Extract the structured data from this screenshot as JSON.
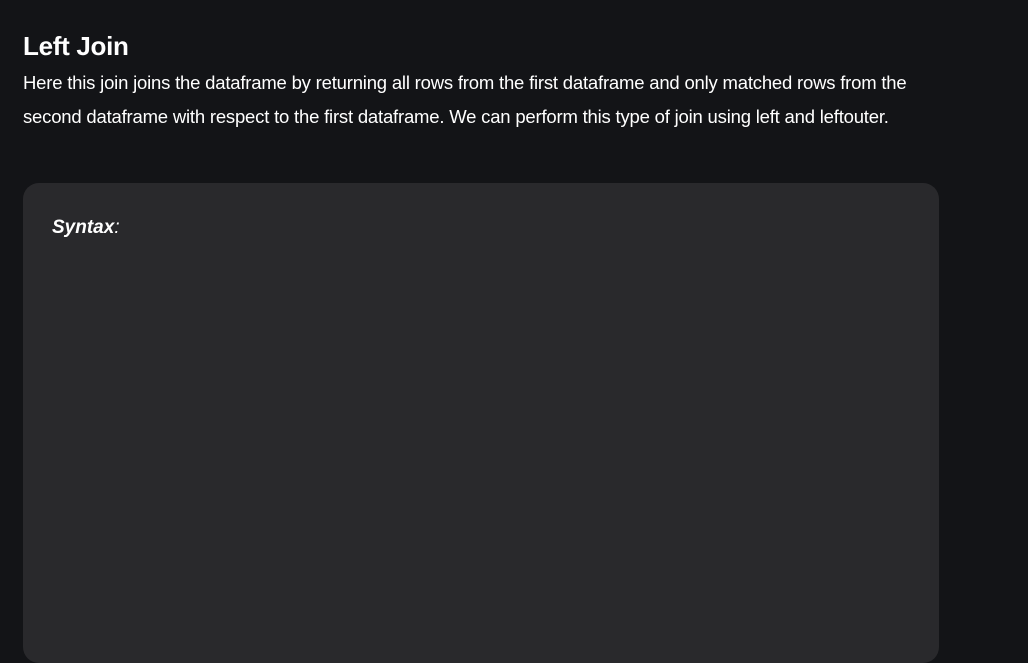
{
  "article": {
    "title": "Left Join",
    "paragraph": "Here this join joins the dataframe by returning all rows from the first dataframe and only matched rows from the second dataframe with respect to the first dataframe. We can perform this type of join using left and leftouter.",
    "syntax_label": "Syntax",
    "syntax_colon": ":"
  },
  "colors": {
    "background": "#131417",
    "code_box": "#29292c",
    "text": "#ffffff"
  }
}
